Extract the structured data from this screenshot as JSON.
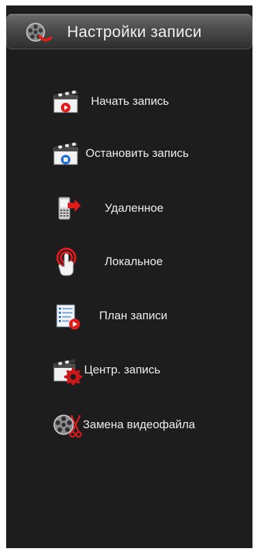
{
  "header": {
    "title": "Настройки записи",
    "icon": "film-reel-record-icon"
  },
  "menu": {
    "items": [
      {
        "label": "Начать запись",
        "icon": "clapper-record-icon"
      },
      {
        "label": "Остановить запись",
        "icon": "clapper-stop-icon"
      },
      {
        "label": "Удаленное",
        "icon": "phone-remote-icon"
      },
      {
        "label": "Локальное",
        "icon": "hand-touch-icon"
      },
      {
        "label": "План записи",
        "icon": "schedule-list-icon"
      },
      {
        "label": "Центр. запись",
        "icon": "clapper-gear-icon"
      },
      {
        "label": "Замена видеофайла",
        "icon": "film-reel-cut-icon"
      }
    ]
  },
  "colors": {
    "panel": "#1d1d1d",
    "accent_red": "#e21b1b",
    "accent_blue": "#2a6fd6",
    "text": "#eeeeee"
  }
}
